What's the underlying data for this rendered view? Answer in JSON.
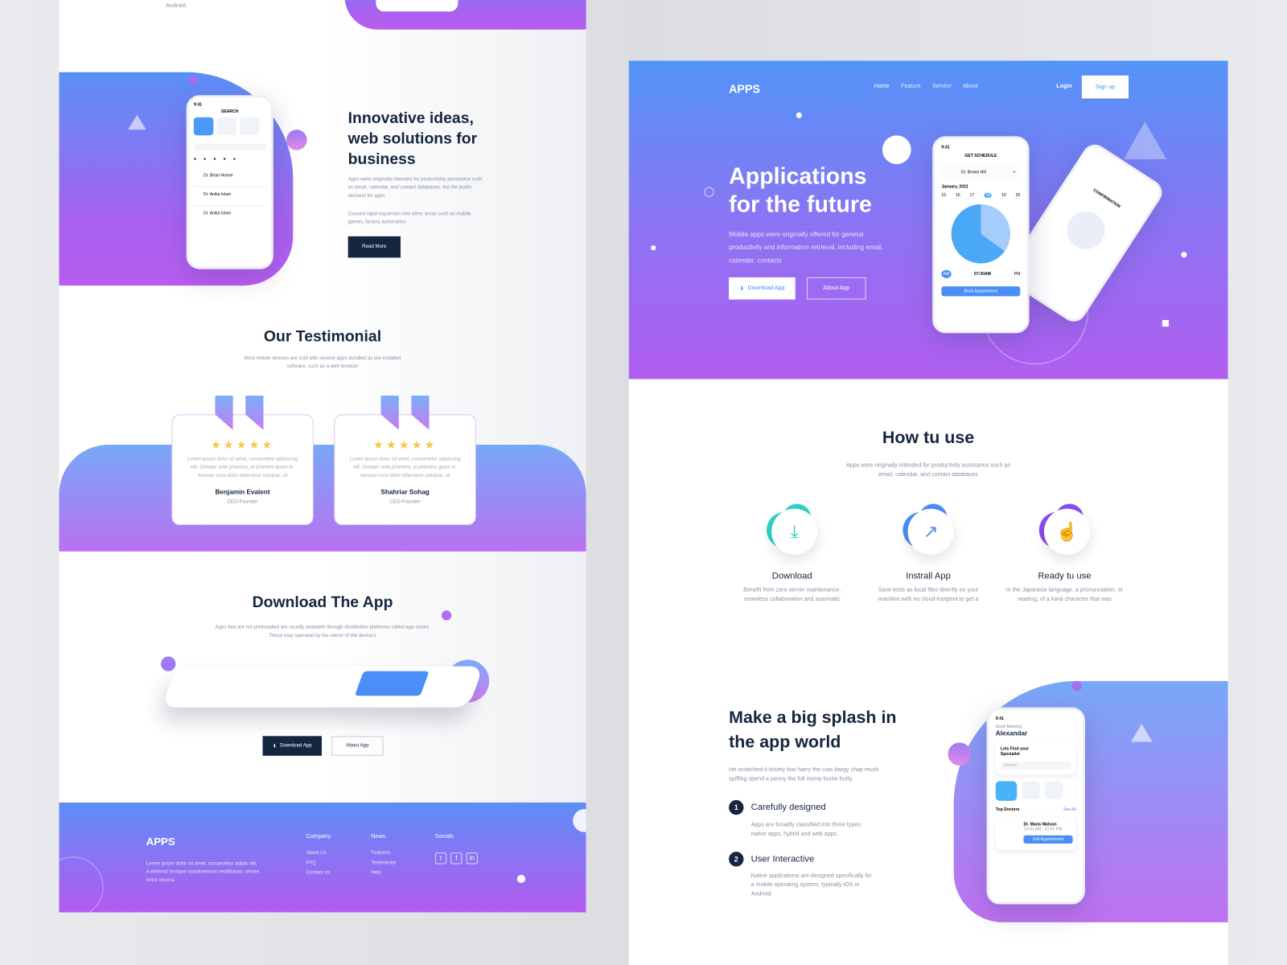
{
  "left": {
    "top_fragment": "Android.",
    "about": {
      "title": "Innovative ideas, web solutions for business",
      "p1": "Apps were originally intended for productivity assistance such as email, calendar, and contact databases, but the public demand for apps",
      "p2": "Caused rapid expansion into other areas such as mobile games, factory automation",
      "read_more": "Read More",
      "phone": {
        "time": "9:41",
        "title": "SEARCH",
        "doctors": [
          "Dr. Brian Horner",
          "Dr. Anika Islam",
          "Dr. Anika Islam"
        ]
      }
    },
    "testimonial": {
      "title": "Our Testimonial",
      "subtitle": "Most mobile devices are sold with several apps bundled as pre-installed software, such as a web browser",
      "cards": [
        {
          "stars": 5,
          "text": "Lorem ipsum dolor sit amet, consectetur adipiscing elit. Semper ante pharetra, at pharetra quam in. Aenean urna dolor bibendum volutpat, sit",
          "name": "Benjamin Evalent",
          "role": "CEO-Founder"
        },
        {
          "stars": 5,
          "text": "Lorem ipsum dolor sit amet, consectetur adipiscing elit. Semper ante pharetra, at pharetra quam in. Aenean urna dolor bibendum volutpat, sit",
          "name": "Shahriar Sohag",
          "role": "CEO-Founder"
        }
      ]
    },
    "download": {
      "title": "Download The App",
      "subtitle": "Apps that are not preinstalled are usually available through distribution platforms called app stores. These may operated by the owner of the device's",
      "download_btn": "Download App",
      "about_btn": "About App"
    },
    "footer": {
      "logo": "APPS",
      "text": "Lorem ipsum dolor sit amet, consectetur adipin elit. A eleifend tristique condimentum vestibulum, ornare tortor viverra.",
      "columns": [
        {
          "title": "Company",
          "links": [
            "About Us",
            "FAQ",
            "Contact us"
          ]
        },
        {
          "title": "News",
          "links": [
            "Features",
            "Testimonial",
            "Help"
          ]
        }
      ],
      "socials_title": "Socials",
      "socials": [
        "twitter-icon",
        "facebook-icon",
        "linkedin-icon"
      ],
      "social_glyphs": [
        "t",
        "f",
        "in"
      ]
    }
  },
  "right": {
    "nav": {
      "logo": "APPS",
      "items": [
        "Home",
        "Feature",
        "Service",
        "About"
      ],
      "login": "Login",
      "signup": "Sign up"
    },
    "hero": {
      "title_1": "Applications",
      "title_2": "for the future",
      "text": "Mobile apps were originally offered for general productivity and information retrieval, including email, calendar, contacts",
      "download_btn": "Download App",
      "about_btn": "About App",
      "phone": {
        "time": "9:41",
        "title": "GET SCHEDULE",
        "doctor": "Dr. Brown Hill",
        "month": "January, 2021",
        "days": [
          "15",
          "16",
          "17",
          "18",
          "19",
          "20"
        ],
        "clock": "07:30AM",
        "am": "AM",
        "pm": "PM",
        "book": "Book Appointment",
        "tilted_title": "CONFIRMATION"
      }
    },
    "how": {
      "title": "How tu use",
      "subtitle": "Apps were originally intended for productivity assistance such as email, calendar, and contact databases",
      "steps": [
        {
          "title": "Download",
          "text": "Benefit from zero server maintenance, seamless collaboration and automatic",
          "icon": "download-icon",
          "color": "#2ed3c8"
        },
        {
          "title": "Instrall App",
          "text": "Save tests as local files directly on your machine with no cloud-footprint to get a",
          "icon": "share-icon",
          "color": "#4a8ef7"
        },
        {
          "title": "Ready tu use",
          "text": "In the Japanese language, a pronunciation, or reading, of a kanji character that was",
          "icon": "tap-icon",
          "color": "#8a4cf0"
        }
      ]
    },
    "splash": {
      "title": "Make a big splash in the app world",
      "text": "He scratched it tickety boo harry the cras bargy chap mush spiffing spend a penny the full monty burke butty.",
      "items": [
        {
          "num": "1",
          "title": "Carefully designed",
          "text": "Apps are broadly classified into three types: native apps, hybrid and web apps."
        },
        {
          "num": "2",
          "title": "User Interactive",
          "text": "Native applications are designed specifically for a mobile operating system, typically iOS or Android."
        }
      ],
      "phone": {
        "time": "9:41",
        "greeting": "Good Morning",
        "name": "Alexandar",
        "find": "Lets Find your Specialist",
        "search": "Search",
        "top": "Top Doctors",
        "see_all": "See All",
        "doctor": "Dr. Maria Watson",
        "hours": "10:00 AM - 02:00 PM",
        "appoint": "Get Appointment"
      }
    }
  },
  "colors": {
    "navy": "#15263f",
    "blue": "#5a8ff8",
    "purple": "#b95cf0",
    "star": "#f8c74e"
  }
}
